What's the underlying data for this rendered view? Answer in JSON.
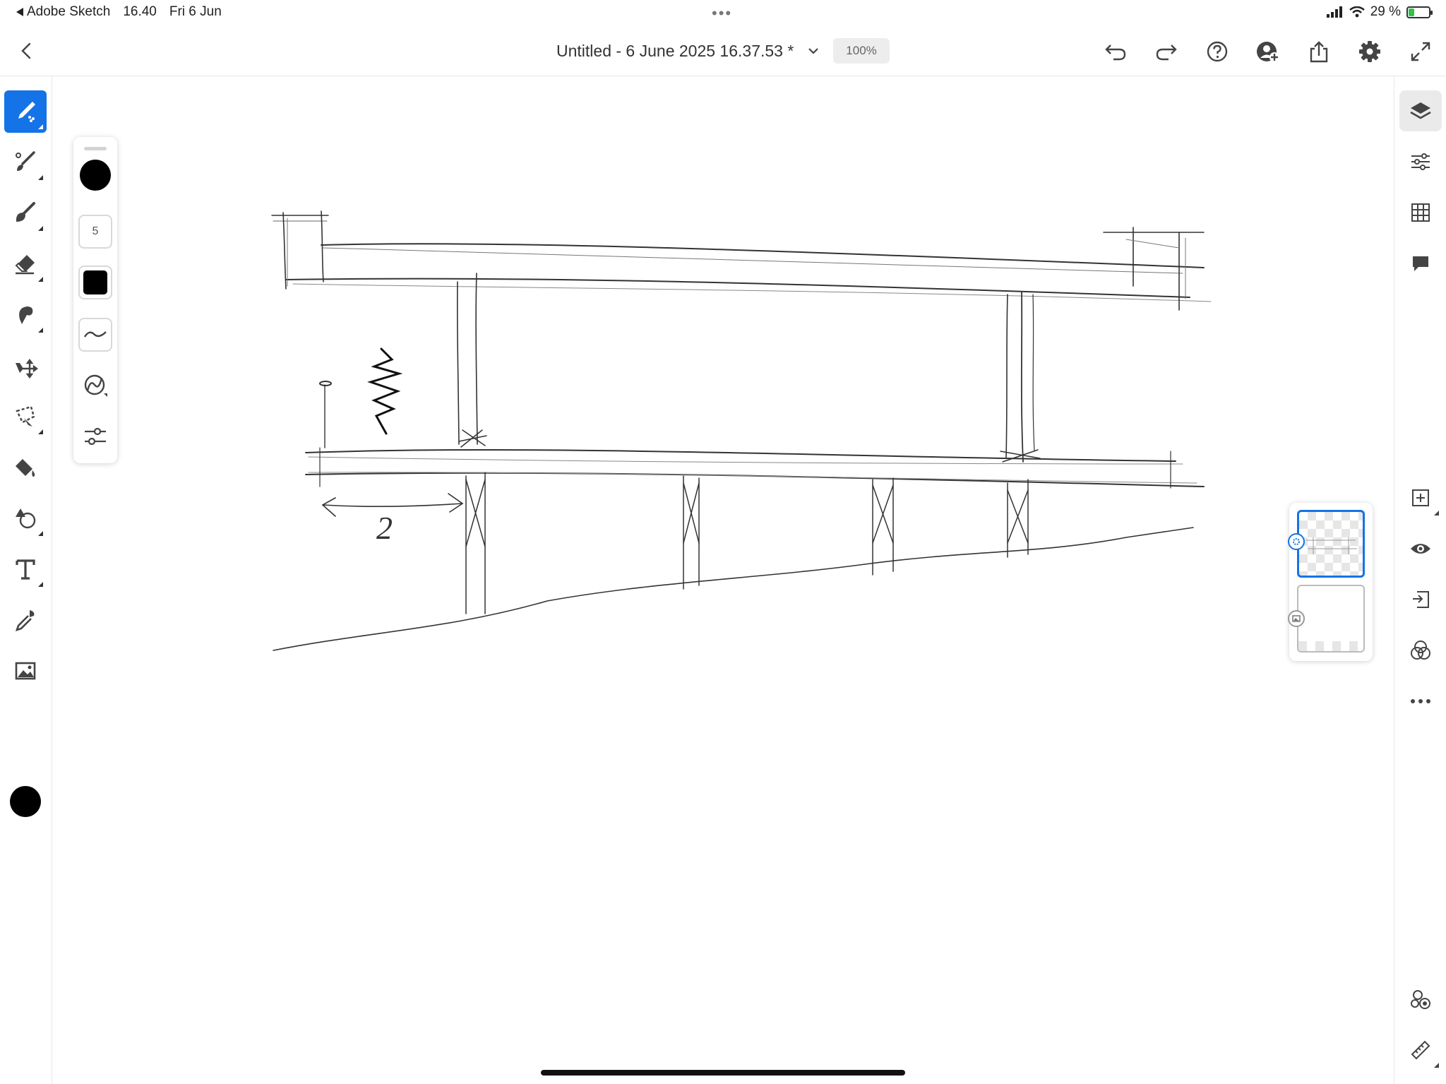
{
  "status_bar": {
    "back_app": "Adobe Sketch",
    "time": "16.40",
    "date": "Fri 6 Jun",
    "center_dots": "•••",
    "battery": "29 %",
    "battery_level": 0.29,
    "battery_color": "#30c24a"
  },
  "topbar": {
    "title": "Untitled - 6 June 2025 16.37.53 *",
    "zoom": "100%",
    "icons": [
      "back-icon",
      "chevron-down-icon",
      "undo-icon",
      "redo-icon",
      "help-icon",
      "invite-user-icon",
      "share-icon",
      "settings-gear-icon",
      "fullscreen-icon"
    ]
  },
  "left_toolbar": {
    "tools": [
      "pencil-brush-icon",
      "ink-brush-icon",
      "paint-brush-icon",
      "eraser-icon",
      "smudge-icon",
      "move-transform-icon",
      "lasso-select-icon",
      "fill-bucket-icon",
      "shape-icon",
      "text-icon",
      "eyedropper-icon",
      "image-icon"
    ],
    "active_tool": "pencil-brush-icon",
    "current_color": "#000000",
    "accent_color": "#1473e6"
  },
  "brush_panel": {
    "size_value": "5",
    "brush_color": "#000000",
    "items": [
      "brush-size-dot",
      "size-field",
      "opacity-swatch",
      "pressure-curve-icon",
      "stroke-smoothing-icon",
      "brush-settings-icon"
    ]
  },
  "right_toolbar": {
    "tools": [
      "layers-icon",
      "adjustments-icon",
      "grid-icon",
      "comments-icon",
      "add-layer-icon",
      "visibility-eye-icon",
      "merge-down-icon",
      "blend-mode-icon",
      "more-options-icon",
      "shapes-stencil-icon",
      "ruler-icon"
    ],
    "active_tool": "layers-icon"
  },
  "layers": [
    {
      "name": "layer-1",
      "selected": true
    },
    {
      "name": "background-layer",
      "selected": false
    }
  ],
  "sketch": {
    "annotation": "2"
  }
}
